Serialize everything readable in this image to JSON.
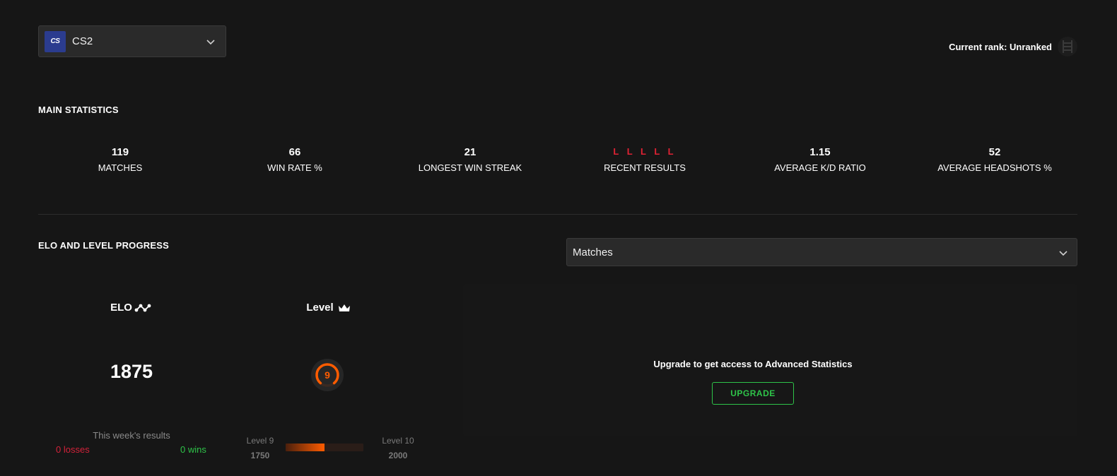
{
  "game_selector": {
    "logo_text": "CS",
    "game": "CS2"
  },
  "rank": {
    "text": "Current rank: Unranked",
    "icon": "unranked-rank-icon"
  },
  "main_statistics": {
    "title": "MAIN STATISTICS",
    "stats": [
      {
        "value": "119",
        "label": "MATCHES"
      },
      {
        "value": "66",
        "label": "WIN RATE %"
      },
      {
        "value": "21",
        "label": "LONGEST WIN STREAK"
      },
      {
        "value": "L L L L L",
        "label": "RECENT RESULTS"
      },
      {
        "value": "1.15",
        "label": "AVERAGE K/D RATIO"
      },
      {
        "value": "52",
        "label": "AVERAGE HEADSHOTS %"
      }
    ]
  },
  "progress_section": {
    "title": "ELO AND LEVEL PROGRESS",
    "range_select": "Matches",
    "elo": {
      "header": "ELO",
      "value": "1875",
      "week_title": "This week's results",
      "losses": "0 losses",
      "wins": "0 wins"
    },
    "level": {
      "header": "Level",
      "current_level": "9",
      "from_label": "Level 9",
      "from_elo": "1750",
      "to_label": "Level 10",
      "to_elo": "2000",
      "progress_fraction": 0.5
    },
    "upgrade": {
      "message": "Upgrade to get access to Advanced Statistics",
      "button": "UPGRADE"
    }
  },
  "colors": {
    "background": "#161616",
    "loss_red": "#e02234",
    "win_green": "#2ec449",
    "level_orange": "#ff5c00"
  }
}
